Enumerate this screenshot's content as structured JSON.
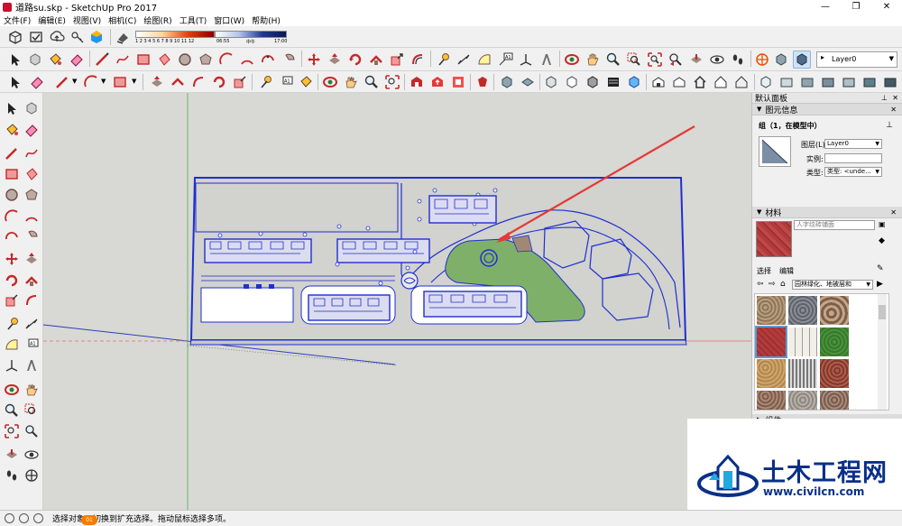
{
  "window": {
    "title": "道路su.skp - SketchUp Pro 2017",
    "controls": [
      "—",
      "❐",
      "✕"
    ]
  },
  "menu": [
    "文件(F)",
    "编辑(E)",
    "视图(V)",
    "相机(C)",
    "绘图(R)",
    "工具(T)",
    "窗口(W)",
    "帮助(H)"
  ],
  "shadow": {
    "ticks": "1 2 3 4 5 6 7 8 9 10 11 12",
    "time_start": "06:55",
    "time_mid": "中午",
    "time_end": "17:00"
  },
  "layer_select": "Layer0",
  "panel": {
    "title": "默认面板",
    "entity_info": {
      "header": "图元信息",
      "entity": "组（1，在模型中）",
      "layer_label": "图层(L):",
      "layer_value": "Layer0",
      "instance_label": "实例:",
      "instance_value": "",
      "type_label": "类型:",
      "type_value": "类型: <unde..."
    },
    "materials": {
      "header": "材料",
      "material_name": "人字纹砖铺面",
      "tab_select": "选择",
      "tab_edit": "编辑",
      "library": "园林绿化、地被层和"
    },
    "next_section": "组件"
  },
  "status": {
    "text": "选择对象。切换到扩充选择。拖动鼠标选择多项。",
    "badge": "01"
  },
  "watermark": {
    "title": "土木工程网",
    "url": "www.civilcn.com"
  },
  "colors": {
    "model_lines": "#1f2fd0",
    "lawn": "#7fb069",
    "pointer_arrow": "#e53935",
    "canvas": "#d8d8d4"
  }
}
